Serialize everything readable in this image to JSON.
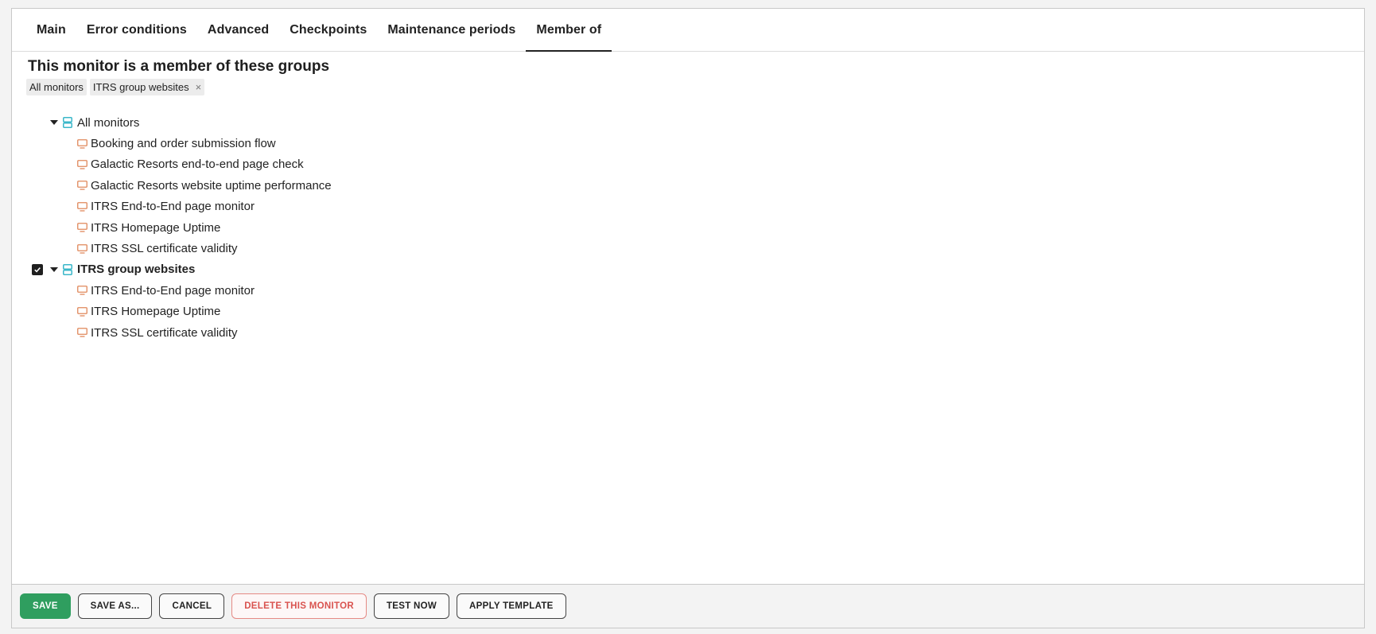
{
  "tabs": [
    {
      "label": "Main"
    },
    {
      "label": "Error conditions"
    },
    {
      "label": "Advanced"
    },
    {
      "label": "Checkpoints"
    },
    {
      "label": "Maintenance periods"
    },
    {
      "label": "Member of"
    }
  ],
  "active_tab": "Member of",
  "section_title": "This monitor is a member of these groups",
  "chips": [
    {
      "label": "All monitors",
      "removable": false
    },
    {
      "label": "ITRS group websites",
      "removable": true
    }
  ],
  "chip_remove_glyph": "×",
  "tree": {
    "groups": [
      {
        "label": "All monitors",
        "checked": false,
        "expanded": true,
        "icon": "server-group-icon",
        "monitors": [
          "Booking and order submission flow",
          "Galactic Resorts end-to-end page check",
          "Galactic Resorts website uptime performance",
          "ITRS End-to-End page monitor",
          "ITRS Homepage Uptime",
          "ITRS SSL certificate validity"
        ]
      },
      {
        "label": "ITRS group websites",
        "checked": true,
        "expanded": true,
        "icon": "server-group-icon",
        "monitors": [
          "ITRS End-to-End page monitor",
          "ITRS Homepage Uptime",
          "ITRS SSL certificate validity"
        ]
      }
    ],
    "monitor_icon": "monitor-icon"
  },
  "footer": {
    "save": "SAVE",
    "save_as": "SAVE AS...",
    "cancel": "CANCEL",
    "delete": "DELETE THIS MONITOR",
    "test_now": "TEST NOW",
    "apply_template": "APPLY TEMPLATE"
  },
  "colors": {
    "primary": "#2f9e5f",
    "danger": "#d9534f",
    "group_icon": "#3bb7c9",
    "monitor_icon": "#e0875a"
  }
}
